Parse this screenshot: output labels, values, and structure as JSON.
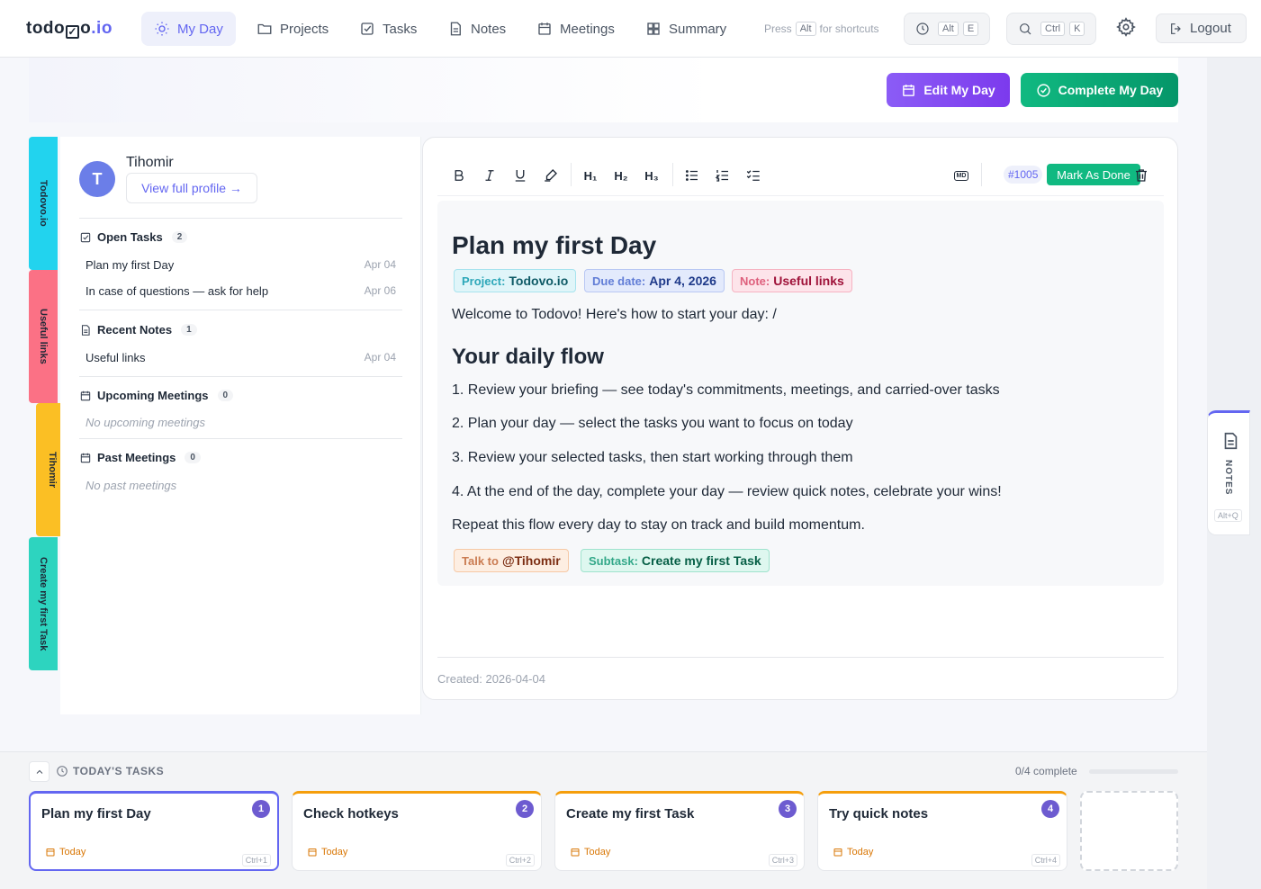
{
  "app": {
    "logo_left": "todo",
    "logo_box": "✓",
    "logo_right": "o",
    "logo_dot": ".io"
  },
  "nav": {
    "items": [
      {
        "label": "My Day",
        "icon": "sun-icon"
      },
      {
        "label": "Projects",
        "icon": "folder-icon"
      },
      {
        "label": "Tasks",
        "icon": "checkbox-icon"
      },
      {
        "label": "Notes",
        "icon": "document-icon"
      },
      {
        "label": "Meetings",
        "icon": "calendar-icon"
      },
      {
        "label": "Summary",
        "icon": "grid-icon"
      }
    ],
    "hint_press": "Press",
    "hint_key": "Alt",
    "hint_text": "for shortcuts",
    "clock_keys": [
      "Alt",
      "E"
    ],
    "search_keys": [
      "Ctrl",
      "K"
    ],
    "logout": "Logout"
  },
  "actions": {
    "edit": "Edit My Day",
    "complete": "Complete My Day"
  },
  "vtabs": [
    "Todovo.io",
    "Useful links",
    "Tihomir",
    "Create my first Task"
  ],
  "colors": {
    "accent": "#6366f1",
    "success": "#10b981",
    "tab1": "#22d3ee",
    "tab2": "#fb7185",
    "tab3": "#fbbf24",
    "tab4": "#2dd4bf"
  },
  "profile": {
    "initial": "T",
    "name": "Tihomir",
    "link": "View full profile →"
  },
  "sections": {
    "open_tasks": {
      "title": "Open Tasks",
      "count": "2",
      "rows": [
        {
          "label": "Plan my first Day",
          "date": "Apr 04"
        },
        {
          "label": "In case of questions — ask for help",
          "date": "Apr 06"
        }
      ]
    },
    "recent_notes": {
      "title": "Recent Notes",
      "count": "1",
      "rows": [
        {
          "label": "Useful links",
          "date": "Apr 04"
        }
      ]
    },
    "upcoming_meetings": {
      "title": "Upcoming Meetings",
      "count": "0",
      "empty": "No upcoming meetings"
    },
    "past_meetings": {
      "title": "Past Meetings",
      "count": "0",
      "empty": "No past meetings"
    }
  },
  "editor": {
    "toolbar": {
      "h1": "H₁",
      "h2": "H₂",
      "h3": "H₃",
      "md": "MD"
    },
    "id": "#1005",
    "mark_done": "Mark As Done",
    "title": "Plan my first Day",
    "chips": [
      {
        "key": "Project:",
        "value": "Todovo.io"
      },
      {
        "key": "Due date:",
        "value": "Apr 4, 2026"
      },
      {
        "key": "Note:",
        "value": "Useful links"
      }
    ],
    "intro": "Welcome to Todovo! Here's how to start your day: /",
    "h2": "Your daily flow",
    "steps": [
      "1. Review your briefing — see today's commitments, meetings, and carried-over tasks",
      "2. Plan your day — select the tasks you want to focus on today",
      "3. Review your selected tasks, then start working through them",
      "4. At the end of the day, complete your day — review quick notes, celebrate your wins!"
    ],
    "outro": "Repeat this flow every day to stay on track and build momentum.",
    "tag_chips": [
      {
        "key": "Talk to",
        "value": "@Tihomir"
      },
      {
        "key": "Subtask:",
        "value": "Create my first Task"
      }
    ],
    "created": "Created: 2026-04-04"
  },
  "notes_tab": {
    "label": "NOTES",
    "kbd": "Alt+Q"
  },
  "today": {
    "title": "TODAY'S TASKS",
    "progress": "0/4 complete",
    "progress_fraction": 0,
    "cards": [
      {
        "title": "Plan my first Day",
        "num": "1",
        "today": "Today",
        "kbd": "Ctrl+1"
      },
      {
        "title": "Check hotkeys",
        "num": "2",
        "today": "Today",
        "kbd": "Ctrl+2"
      },
      {
        "title": "Create my first Task",
        "num": "3",
        "today": "Today",
        "kbd": "Ctrl+3"
      },
      {
        "title": "Try quick notes",
        "num": "4",
        "today": "Today",
        "kbd": "Ctrl+4"
      }
    ]
  }
}
